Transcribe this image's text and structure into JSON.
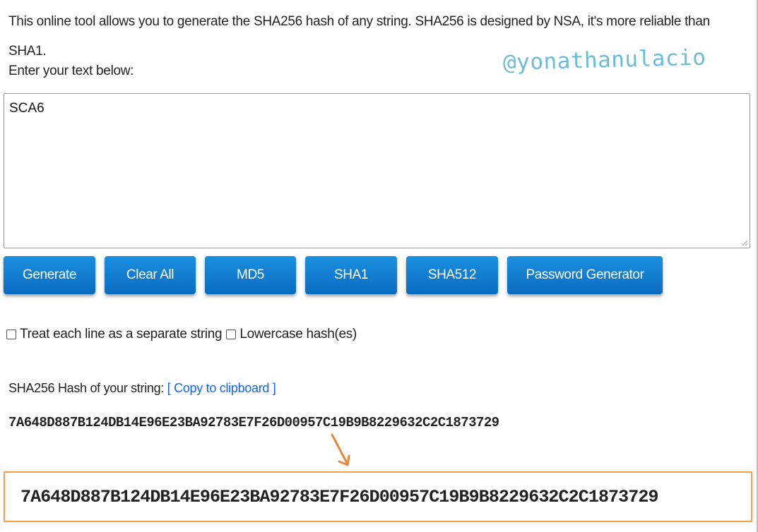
{
  "intro_text": "This online tool allows you to generate the SHA256 hash of any string. SHA256 is designed by NSA, it's more reliable than SHA1.",
  "enter_label": "Enter your text below:",
  "watermark": "@yonathanulacio",
  "input": {
    "value": "SCA6"
  },
  "buttons": {
    "generate": "Generate",
    "clear_all": "Clear All",
    "md5": "MD5",
    "sha1": "SHA1",
    "sha512": "SHA512",
    "password_generator": "Password Generator"
  },
  "options": {
    "separate_lines": {
      "label": "Treat each line as a separate string",
      "checked": false
    },
    "lowercase": {
      "label": "Lowercase hash(es)",
      "checked": false
    }
  },
  "result": {
    "label": "SHA256 Hash of your string:",
    "copy_link": "[ Copy to clipboard ]",
    "hash": "7A648D887B124DB14E96E23BA92783E7F26D00957C19B9B8229632C2C1873729"
  },
  "highlight": {
    "hash": "7A648D887B124DB14E96E23BA92783E7F26D00957C19B9B8229632C2C1873729",
    "border_color": "#f0a050",
    "arrow_color": "#e8873a"
  },
  "colors": {
    "button_blue": "#0a7fd6",
    "link_blue": "#1565e0",
    "watermark": "#6bbcd8"
  }
}
